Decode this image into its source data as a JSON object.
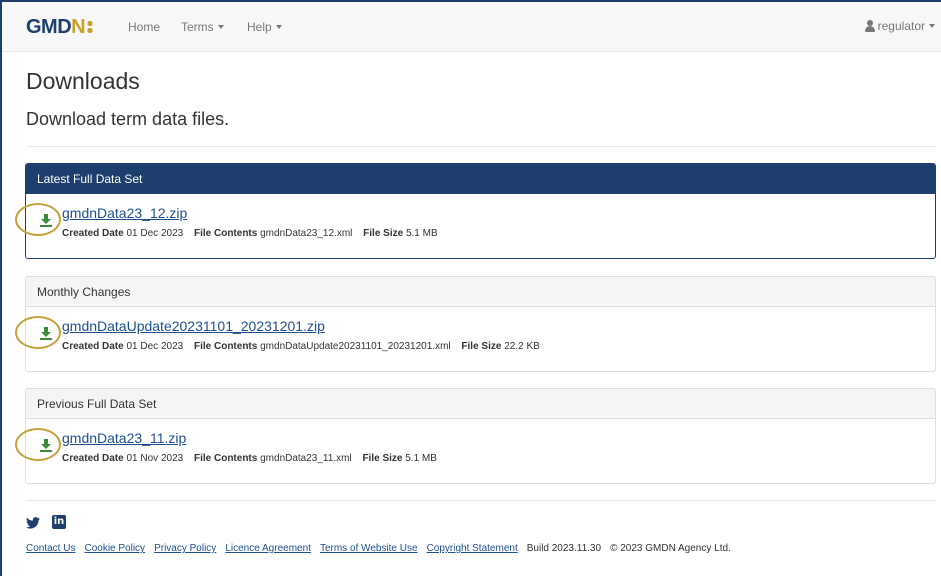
{
  "colors": {
    "navy": "#1d3f6e",
    "gold": "#c9a227",
    "link": "#1f4f8f",
    "download_icon": "#3a8a3a"
  },
  "navbar": {
    "brand_left": "GMD",
    "brand_right": "N",
    "home": "Home",
    "terms": "Terms",
    "help": "Help",
    "user": "regulator",
    "user_icon": "user-icon"
  },
  "page": {
    "title": "Downloads",
    "subtitle": "Download term data files."
  },
  "labels": {
    "created": "Created Date",
    "contents": "File Contents",
    "size": "File Size"
  },
  "panels": [
    {
      "heading": "Latest Full Data Set",
      "file": "gmdnData23_12.zip",
      "created": "01 Dec 2023",
      "contents": "gmdnData23_12.xml",
      "size": "5.1 MB",
      "icon": "download-icon"
    },
    {
      "heading": "Monthly Changes",
      "file": "gmdnDataUpdate20231101_20231201.zip",
      "created": "01 Dec 2023",
      "contents": "gmdnDataUpdate20231101_20231201.xml",
      "size": "22.2 KB",
      "icon": "download-icon"
    },
    {
      "heading": "Previous Full Data Set",
      "file": "gmdnData23_11.zip",
      "created": "01 Nov 2023",
      "contents": "gmdnData23_11.xml",
      "size": "5.1 MB",
      "icon": "download-icon"
    }
  ],
  "social": {
    "twitter_icon": "twitter-icon",
    "linkedin": "in"
  },
  "footer": {
    "links": [
      "Contact Us",
      "Cookie Policy",
      "Privacy Policy",
      "Licence Agreement",
      "Terms of Website Use",
      "Copyright Statement"
    ],
    "build": "Build 2023.11.30",
    "copyright": "© 2023 GMDN Agency Ltd."
  }
}
